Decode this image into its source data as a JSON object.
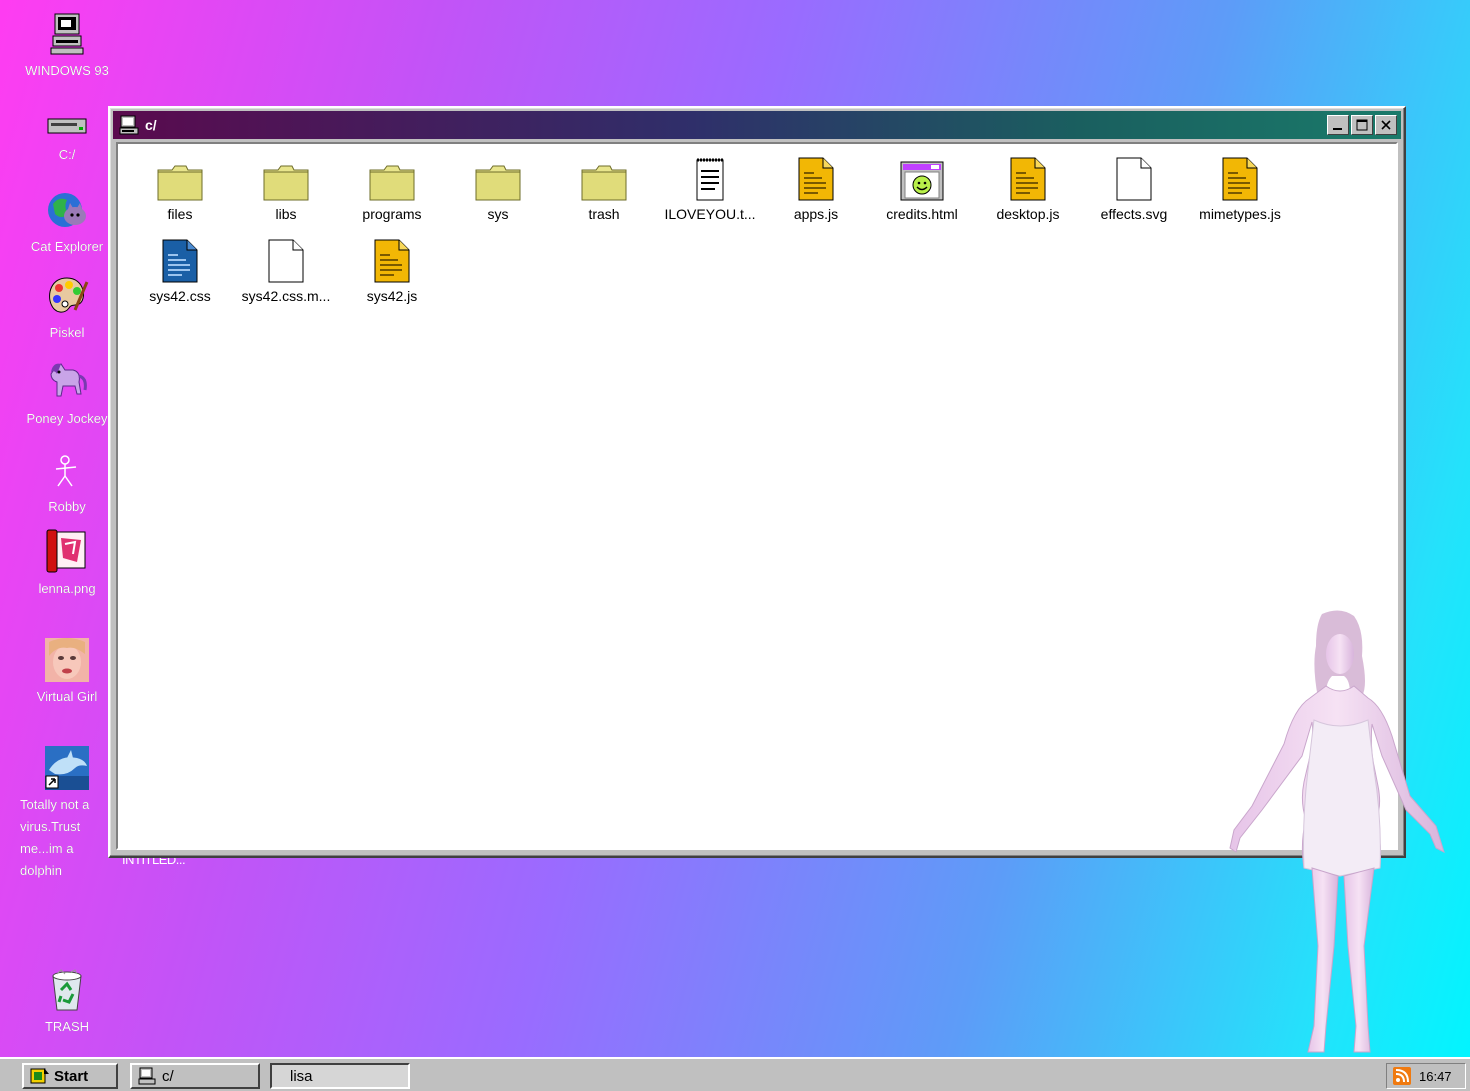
{
  "desktop": {
    "icons": [
      {
        "label": "WINDOWS 93",
        "icon": "computer-icon"
      },
      {
        "label": "C:/",
        "icon": "drive-icon"
      },
      {
        "label": "Cat Explorer",
        "icon": "cat-globe-icon"
      },
      {
        "label": "Piskel",
        "icon": "paint-palette-icon"
      },
      {
        "label": "Poney Jockey",
        "icon": "pony-icon"
      },
      {
        "label": "Robby",
        "icon": "stick-figure-icon"
      },
      {
        "label": "lenna.png",
        "icon": "image-file-icon"
      },
      {
        "label": "Virtual Girl",
        "icon": "face-icon"
      },
      {
        "label": "Totally not a virus.Trust me...im a dolphin",
        "icon": "dolphin-shortcut-icon"
      },
      {
        "label": "TRASH",
        "icon": "recycle-bin-icon"
      }
    ],
    "partial_label": "INTITLED..."
  },
  "window": {
    "title": "c/",
    "buttons": {
      "minimize": "_",
      "maximize": "□",
      "close": "✕"
    },
    "files": [
      {
        "name": "files",
        "type": "folder"
      },
      {
        "name": "libs",
        "type": "folder"
      },
      {
        "name": "programs",
        "type": "folder"
      },
      {
        "name": "sys",
        "type": "folder"
      },
      {
        "name": "trash",
        "type": "folder"
      },
      {
        "name": "ILOVEYOU.t...",
        "type": "notepad"
      },
      {
        "name": "apps.js",
        "type": "js"
      },
      {
        "name": "credits.html",
        "type": "html"
      },
      {
        "name": "desktop.js",
        "type": "js"
      },
      {
        "name": "effects.svg",
        "type": "blank"
      },
      {
        "name": "mimetypes.js",
        "type": "js"
      },
      {
        "name": "sys42.css",
        "type": "css"
      },
      {
        "name": "sys42.css.m...",
        "type": "blank"
      },
      {
        "name": "sys42.js",
        "type": "js"
      }
    ]
  },
  "taskbar": {
    "start_label": "Start",
    "tasks": [
      {
        "label": "c/",
        "pressed": false
      },
      {
        "label": "lisa",
        "pressed": true
      }
    ],
    "clock": "16:47"
  },
  "colors": {
    "js_file": "#f2b705",
    "css_file": "#1a5fa6",
    "folder": "#e8e58c"
  }
}
